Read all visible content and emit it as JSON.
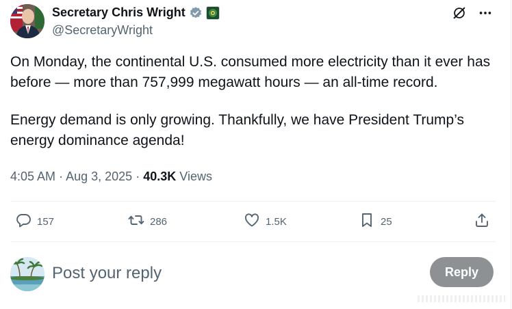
{
  "author": {
    "name": "Secretary Chris Wright",
    "handle": "@SecretaryWright"
  },
  "tweet": {
    "paragraph1": "On Monday, the continental U.S. consumed more electricity than it ever has before — more than 757,999 megawatt hours — an all-time record.",
    "paragraph2": "Energy demand is only growing. Thankfully, we have President Trump’s energy dominance agenda!",
    "time": "4:05 AM",
    "separator": "·",
    "date": "Aug 3, 2025",
    "views_count": "40.3K",
    "views_label": "Views"
  },
  "actions": {
    "replies": "157",
    "reposts": "286",
    "likes": "1.5K",
    "bookmarks": "25"
  },
  "composer": {
    "placeholder": "Post your reply",
    "reply_label": "Reply"
  },
  "icons": {
    "verified": "verified-badge-icon",
    "affiliation": "department-of-energy-icon",
    "grok": "grok-icon",
    "more": "more-icon",
    "reply": "reply-icon",
    "repost": "repost-icon",
    "like": "like-icon",
    "bookmark": "bookmark-icon",
    "share": "share-icon"
  },
  "colors": {
    "text": "#0f1419",
    "secondary": "#536471",
    "verified_blue": "#829aab",
    "reply_button": "#8d9194",
    "divider": "#eff3f4"
  }
}
